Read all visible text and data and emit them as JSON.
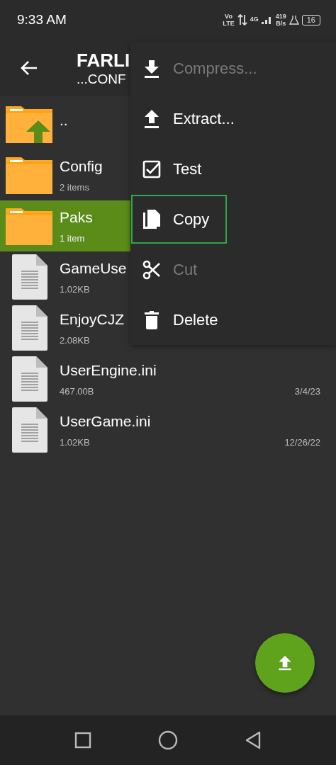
{
  "status_bar": {
    "time": "9:33 AM",
    "volte": [
      "Vo",
      "LTE"
    ],
    "network": "4G",
    "speed": [
      "419",
      "B/s"
    ],
    "battery": "16"
  },
  "toolbar": {
    "title": "FARLI",
    "subtitle": "...CONF"
  },
  "files": [
    {
      "kind": "parent",
      "name": "..",
      "selected": false
    },
    {
      "kind": "folder",
      "name": "Config",
      "detail": "2 items",
      "selected": false
    },
    {
      "kind": "folder",
      "name": "Paks",
      "detail": "1 item",
      "selected": true
    },
    {
      "kind": "file",
      "name": "GameUse",
      "detail": "1.02KB",
      "selected": false
    },
    {
      "kind": "file",
      "name": "EnjoyCJZ",
      "detail": "2.08KB",
      "selected": false
    },
    {
      "kind": "file",
      "name": "UserEngine.ini",
      "detail": "467.00B",
      "date": "3/4/23",
      "selected": false
    },
    {
      "kind": "file",
      "name": "UserGame.ini",
      "detail": "1.02KB",
      "date": "12/26/22",
      "selected": false
    }
  ],
  "menu": [
    {
      "kind": "download",
      "label": "Compress...",
      "disabled": true,
      "selected": false
    },
    {
      "kind": "upload",
      "label": "Extract...",
      "disabled": false,
      "selected": false
    },
    {
      "kind": "check",
      "label": "Test",
      "disabled": false,
      "selected": false
    },
    {
      "kind": "copy",
      "label": "Copy",
      "disabled": false,
      "selected": true
    },
    {
      "kind": "scissors",
      "label": "Cut",
      "disabled": true,
      "selected": false
    },
    {
      "kind": "trash",
      "label": "Delete",
      "disabled": false,
      "selected": false
    }
  ]
}
